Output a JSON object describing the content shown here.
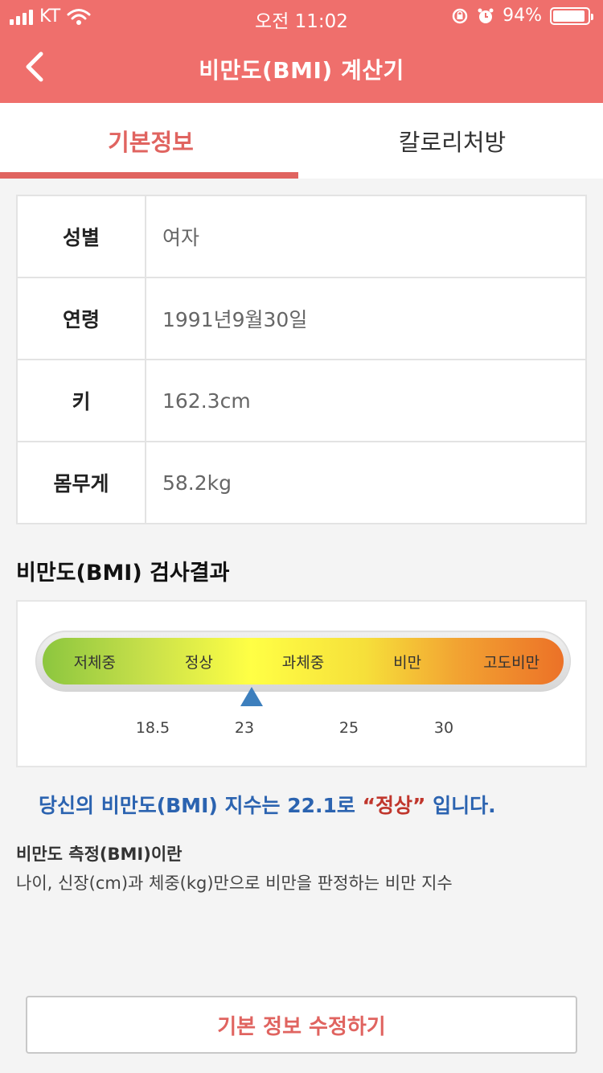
{
  "status_bar": {
    "carrier": "KT",
    "time": "오전 11:02",
    "battery_percent": "94%",
    "battery_level": 0.94
  },
  "nav": {
    "title": "비만도(BMI) 계산기",
    "back_icon": "chevron-left-icon"
  },
  "tabs": [
    {
      "label": "기본정보",
      "active": true
    },
    {
      "label": "칼로리처방",
      "active": false
    }
  ],
  "info": [
    {
      "label": "성별",
      "value": "여자"
    },
    {
      "label": "연령",
      "value": "1991년9월30일"
    },
    {
      "label": "키",
      "value": "162.3cm"
    },
    {
      "label": "몸무게",
      "value": "58.2kg"
    }
  ],
  "result_section": {
    "title": "비만도(BMI) 검사결과",
    "categories": [
      "저체중",
      "정상",
      "과체중",
      "비만",
      "고도비만"
    ],
    "ticks": [
      "18.5",
      "23",
      "25",
      "30"
    ],
    "bmi_value": 22.1,
    "result_prefix": "당신의 비만도(BMI) 지수는 22.1로 ",
    "result_category": "“정상”",
    "result_suffix": " 입니다."
  },
  "definition": {
    "title": "비만도 측정(BMI)이란",
    "description": "나이, 신장(cm)과 체중(kg)만으로 비만을 판정하는 비만 지수"
  },
  "edit_button": {
    "label": "기본 정보 수정하기"
  },
  "colors": {
    "header": "#ef6f6c",
    "accent": "#e06460",
    "result_text": "#2b63b0",
    "result_emphasis": "#c0362c",
    "marker": "#3d7fbd"
  }
}
